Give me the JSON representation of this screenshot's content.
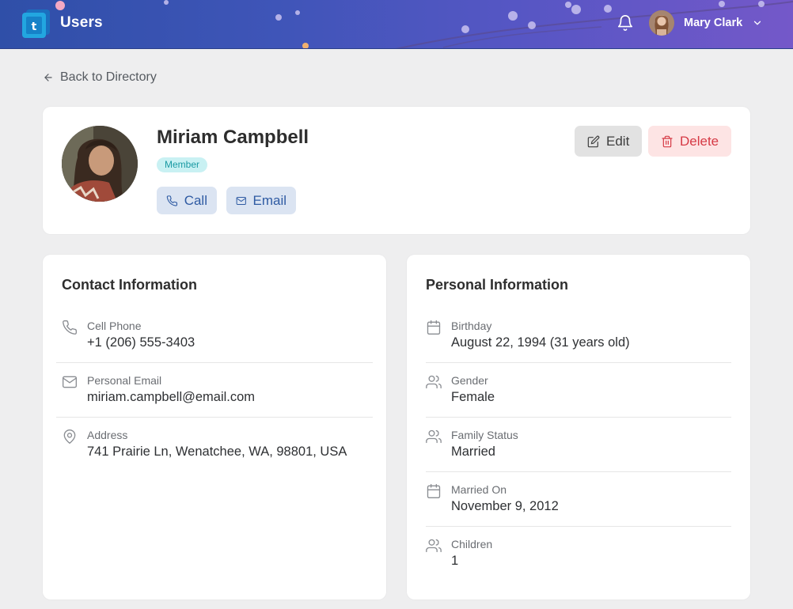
{
  "header": {
    "app_title": "Users",
    "user_name": "Mary Clark",
    "logo_icon": "app-logo-icon",
    "bell_icon": "bell-icon",
    "chevron_icon": "chevron-down-icon"
  },
  "nav": {
    "back_label": "Back to Directory"
  },
  "profile": {
    "name": "Miriam Campbell",
    "role_badge": "Member",
    "call_label": "Call",
    "email_label": "Email",
    "edit_label": "Edit",
    "delete_label": "Delete"
  },
  "contact": {
    "title": "Contact Information",
    "items": [
      {
        "label": "Cell Phone",
        "value": "+1 (206) 555-3403",
        "icon": "phone-icon"
      },
      {
        "label": "Personal Email",
        "value": "miriam.campbell@email.com",
        "icon": "mail-icon"
      },
      {
        "label": "Address",
        "value": "741 Prairie Ln, Wenatchee, WA, 98801, USA",
        "icon": "map-pin-icon"
      }
    ]
  },
  "personal": {
    "title": "Personal Information",
    "items": [
      {
        "label": "Birthday",
        "value": "August 22, 1994 (31 years old)",
        "icon": "calendar-icon"
      },
      {
        "label": "Gender",
        "value": "Female",
        "icon": "users-icon"
      },
      {
        "label": "Family Status",
        "value": "Married",
        "icon": "users-icon"
      },
      {
        "label": "Married On",
        "value": "November 9, 2012",
        "icon": "calendar-icon"
      },
      {
        "label": "Children",
        "value": "1",
        "icon": "users-icon"
      }
    ]
  },
  "colors": {
    "header_gradient_start": "#2f4fa8",
    "header_gradient_end": "#7458c9",
    "badge_bg": "#c9f1f3",
    "badge_text": "#1a9aa3",
    "action_blue": "#2f5ba3",
    "delete_red": "#d63a45"
  }
}
